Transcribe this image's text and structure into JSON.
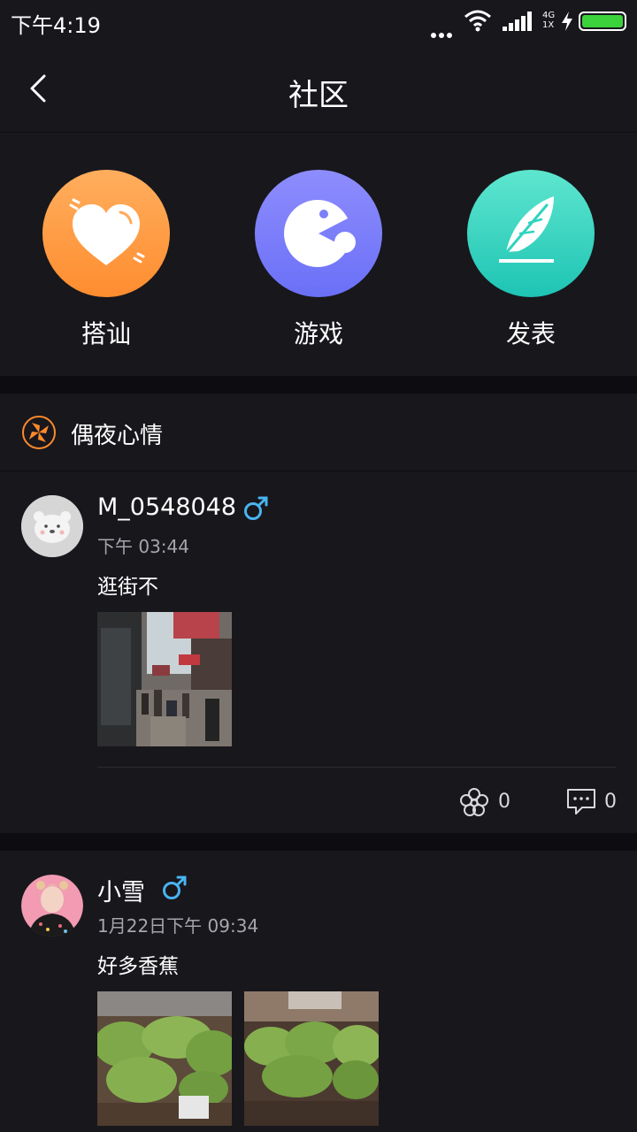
{
  "status_bar": {
    "time": "下午4:19",
    "network_label_top": "4G",
    "network_label_bottom": "1X",
    "battery_color": "#3bd13b"
  },
  "header": {
    "title": "社区",
    "back_icon": "chevron-left-icon"
  },
  "actions": [
    {
      "label": "搭讪",
      "icon": "heart-icon",
      "color": "#ff9a42"
    },
    {
      "label": "游戏",
      "icon": "pacman-icon",
      "color": "#7b7ffa"
    },
    {
      "label": "发表",
      "icon": "feather-icon",
      "color": "#2fd3bf"
    }
  ],
  "section": {
    "title": "偶夜心情",
    "icon": "pinwheel-icon"
  },
  "posts": [
    {
      "username": "M_0548048",
      "gender": "male",
      "time": "下午 03:44",
      "text": "逛街不",
      "avatar": "polar-bear-avatar",
      "photos": [
        "street-photo"
      ],
      "likes": "0",
      "comments": "0"
    },
    {
      "username": "小雪",
      "gender": "male",
      "time": "1月22日下午 09:34",
      "text": "好多香蕉",
      "avatar": "girl-avatar",
      "photos": [
        "banana-photo-1",
        "banana-photo-2"
      ]
    }
  ]
}
